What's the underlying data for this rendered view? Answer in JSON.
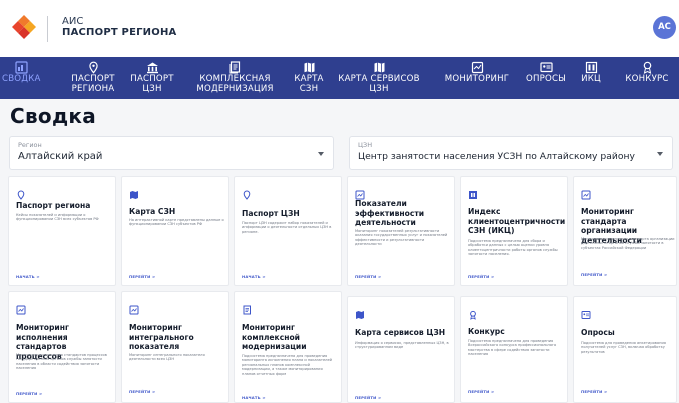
{
  "header": {
    "brand_line1": "АИС",
    "brand_line2": "ПАСПОРТ РЕГИОНА",
    "avatar_initials": "АС"
  },
  "nav": {
    "items": [
      {
        "line1": "СВОДКА",
        "line2": "",
        "icon": "dashboard-icon",
        "active": true
      },
      {
        "line1": "ПАСПОРТ",
        "line2": "РЕГИОНА",
        "icon": "location-pin-icon"
      },
      {
        "line1": "ПАСПОРТ",
        "line2": "ЦЗН",
        "icon": "building-icon"
      },
      {
        "line1": "КОМПЛЕКСНАЯ",
        "line2": "МОДЕРНИЗАЦИЯ",
        "icon": "document-stack-icon"
      },
      {
        "line1": "КАРТА",
        "line2": "СЗН",
        "icon": "map-icon"
      },
      {
        "line1": "КАРТА СЕРВИСОВ",
        "line2": "ЦЗН",
        "icon": "map-icon"
      },
      {
        "line1": "МОНИТОРИНГ",
        "line2": "",
        "icon": "monitoring-icon"
      },
      {
        "line1": "ОПРОСЫ",
        "line2": "",
        "icon": "survey-icon"
      },
      {
        "line1": "ИКЦ",
        "line2": "",
        "icon": "index-icon"
      },
      {
        "line1": "КОНКУРС",
        "line2": "",
        "icon": "award-icon"
      }
    ],
    "colors": {
      "background": "#2f3f8f",
      "active": "#8ea2ff"
    }
  },
  "page": {
    "title": "Сводка"
  },
  "filters": {
    "region": {
      "label": "Регион",
      "value": "Алтайский край"
    },
    "czn": {
      "label": "ЦЗН",
      "value": "Центр занятости населения УСЗН по Алтайскому району"
    }
  },
  "cards": [
    {
      "icon": "location-pin-icon",
      "title": "Паспорт региона",
      "desc": "Кейсы показателей и информации о функционировании СЗН всех субъектов РФ",
      "link": "НАЧАТЬ >"
    },
    {
      "icon": "map-icon",
      "title": "Карта СЗН",
      "desc": "На интерактивной карте представлены данные о функционировании СЗН субъектов РФ",
      "link": "ПЕРЕЙТИ >"
    },
    {
      "icon": "location-pin-icon",
      "title": "Паспорт ЦЗН",
      "desc": "Паспорт ЦЗН содержит набор показателей и информации о деятельности отдельных ЦЗН в регионе.",
      "link": "НАЧАТЬ >"
    },
    {
      "icon": "monitoring-icon",
      "title": "Показатели эффективности деятельности",
      "desc": "Мониторинг показателей результативности оказания государственных услуг и показателей эффективности и результативности деятельности",
      "link": "ПЕРЕЙТИ >"
    },
    {
      "icon": "index-icon",
      "title": "Индекс клиентоцентричности СЗН (ИКЦ)",
      "desc": "Подсистема предназначена для сбора и обработки данных с целью оценки уровня клиентоцентричности работы органов службы занятости населения.",
      "link": "ПЕРЕЙТИ >"
    },
    {
      "icon": "monitoring-icon",
      "title": "Мониторинг стандарта организации деятельности",
      "desc": "Мониторинг исполнения стандарта организации деятельности органов службы занятости в субъектах Российской Федерации",
      "link": "ПЕРЕЙТИ >"
    },
    {
      "icon": "monitoring-icon",
      "title": "Мониторинг исполнения стандартов процессов",
      "desc": "Мониторинг исполнения стандартов процессов государственных органов службы занятости населения в области содействия занятости населения",
      "link": "ПЕРЕЙТИ >"
    },
    {
      "icon": "monitoring-icon",
      "title": "Мониторинг интегрального показателя",
      "desc": "Мониторинг интегрального показателя деятельности всех ЦЗН",
      "link": "ПЕРЕЙТИ >"
    },
    {
      "icon": "document-stack-icon",
      "title": "Мониторинг комплексной модернизации",
      "desc": "Подсистема предназначена для проведения мониторинга исполнения плана и показателей региональных планов комплексной модернизации, а также мониторирования планов отчетных форм",
      "link": "НАЧАТЬ >"
    },
    {
      "icon": "map-icon",
      "title": "Карта сервисов ЦЗН",
      "desc": "Информация о сервисах, представленных ЦЗН, в структурированном виде",
      "link": "ПЕРЕЙТИ >"
    },
    {
      "icon": "award-icon",
      "title": "Конкурс",
      "desc": "Подсистема предназначена для проведения Всероссийского конкурса профессионального мастерства в сфере содействия занятости населения",
      "link": "ПЕРЕЙТИ >"
    },
    {
      "icon": "survey-icon",
      "title": "Опросы",
      "desc": "Подсистема для проведения анкетирования получателей услуг СЗН, включая обработку результатов",
      "link": "ПЕРЕЙТИ >"
    }
  ]
}
